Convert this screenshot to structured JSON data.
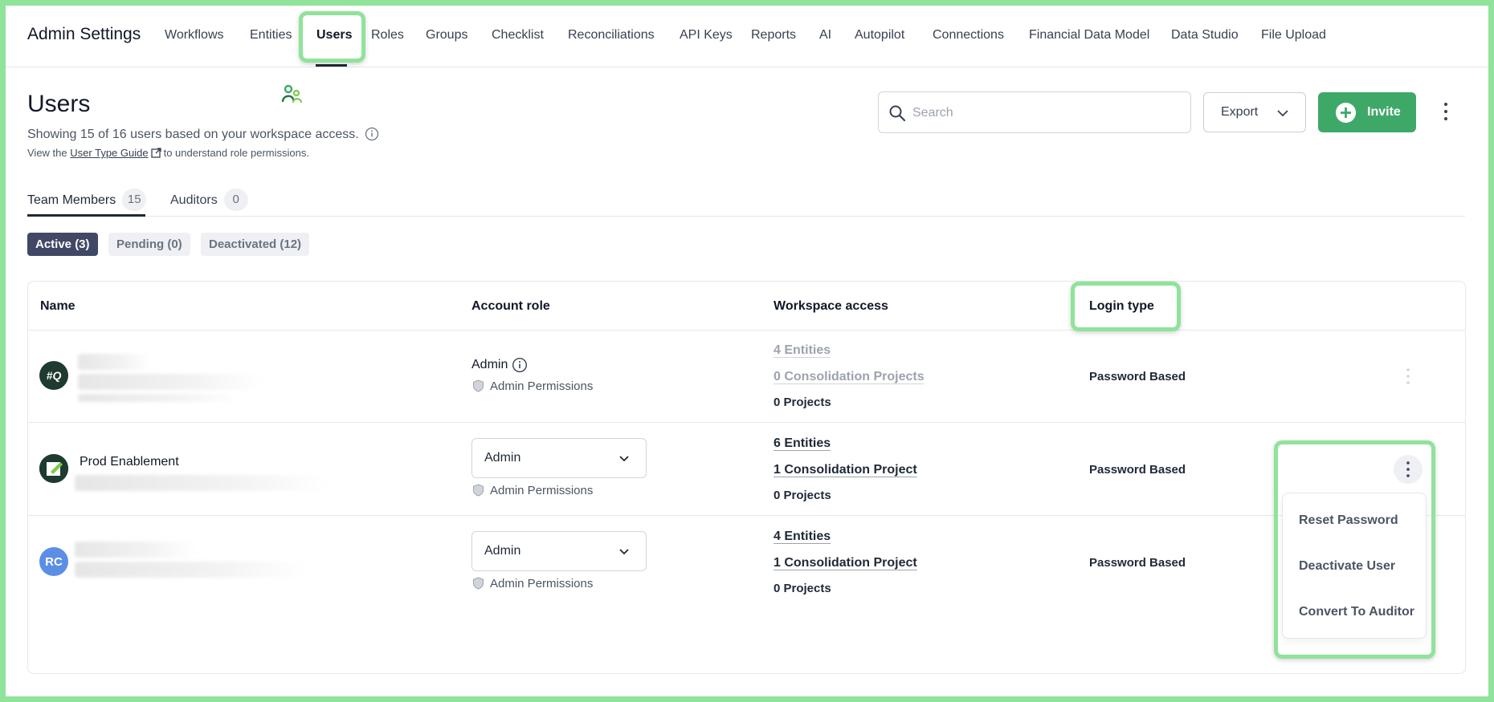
{
  "nav": {
    "title": "Admin Settings",
    "items": [
      "Workflows",
      "Entities",
      "Users",
      "Roles",
      "Groups",
      "Checklist",
      "Reconciliations",
      "API Keys",
      "Reports",
      "AI",
      "Autopilot",
      "Connections",
      "Financial Data Model",
      "Data Studio",
      "File Upload"
    ],
    "active": "Users"
  },
  "header": {
    "title": "Users",
    "subtitle": "Showing 15 of 16 users based on your workspace access.",
    "guide_prefix": "View the",
    "guide_link": "User Type Guide",
    "guide_suffix": "to understand role permissions.",
    "search_placeholder": "Search",
    "export_label": "Export",
    "invite_label": "Invite"
  },
  "tabs": [
    {
      "label": "Team Members",
      "count": "15"
    },
    {
      "label": "Auditors",
      "count": "0"
    }
  ],
  "filters": [
    "Active (3)",
    "Pending (0)",
    "Deactivated (12)"
  ],
  "table": {
    "columns": [
      "Name",
      "Account role",
      "Workspace access",
      "Login type"
    ],
    "rows": [
      {
        "avatar": "#Q",
        "name": "",
        "role": "Admin",
        "permissions": "Admin Permissions",
        "entities": "4 Entities",
        "consolidation": "0 Consolidation Projects",
        "projects": "0 Projects",
        "login": "Password Based"
      },
      {
        "avatar": "",
        "name": "Prod Enablement",
        "role": "Admin",
        "permissions": "Admin Permissions",
        "entities": "6 Entities",
        "consolidation": "1 Consolidation Project",
        "projects": "0 Projects",
        "login": "Password Based"
      },
      {
        "avatar": "RC",
        "name": "",
        "role": "Admin",
        "permissions": "Admin Permissions",
        "entities": "4 Entities",
        "consolidation": "1 Consolidation Project",
        "projects": "0 Projects",
        "login": "Password Based"
      }
    ]
  },
  "row_menu": [
    "Reset Password",
    "Deactivate User",
    "Convert To Auditor"
  ],
  "colors": {
    "accent_green": "#3ea868",
    "active_chip": "#414866",
    "highlight": "#8fe39a",
    "avatar_dark": "#1f3a2e",
    "avatar_blue": "#5b8ee6"
  }
}
